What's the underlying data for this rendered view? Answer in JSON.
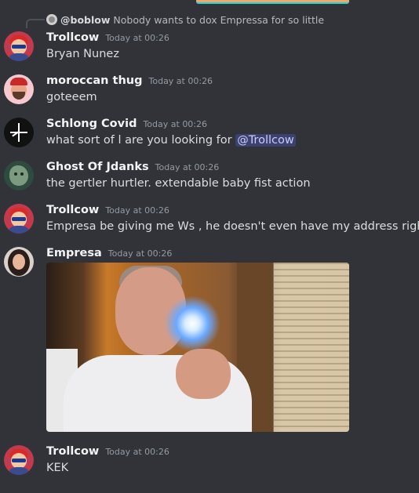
{
  "reply": {
    "username": "@boblow",
    "text": "Nobody wants to dox Empressa for so little"
  },
  "messages": [
    {
      "username": "Trollcow",
      "timestamp": "Today at 00:26",
      "text": "Bryan Nunez",
      "avatar": "trollcow-avatar"
    },
    {
      "username": "moroccan thug",
      "timestamp": "Today at 00:26",
      "text": "goteeem",
      "avatar": "moroccan-thug-avatar"
    },
    {
      "username": "Schlong Covid",
      "timestamp": "Today at 00:26",
      "text": "what sort of l are you looking for ",
      "mention": "@Trollcow",
      "avatar": "schlong-covid-avatar"
    },
    {
      "username": "Ghost Of Jdanks",
      "timestamp": "Today at 00:26",
      "text": "the gertler hurtler. extendable baby fist action",
      "avatar": "ghost-of-jdanks-avatar"
    },
    {
      "username": "Trollcow",
      "timestamp": "Today at 00:26",
      "text": "Empresa be giving me Ws , he doesn't even have my address right",
      "avatar": "trollcow-avatar"
    },
    {
      "username": "Empresa",
      "timestamp": "Today at 00:26",
      "text": "",
      "attachment": "image-of-man-holding-flashlight",
      "avatar": "empresa-avatar"
    },
    {
      "username": "Trollcow",
      "timestamp": "Today at 00:26",
      "text": "KEK",
      "avatar": "trollcow-avatar"
    }
  ],
  "colors": {
    "background": "#313338",
    "username": "#f2f3f5",
    "timestamp": "#949ba4",
    "mention_bg": "#3c4270",
    "mention_text": "#c9cdfb"
  }
}
